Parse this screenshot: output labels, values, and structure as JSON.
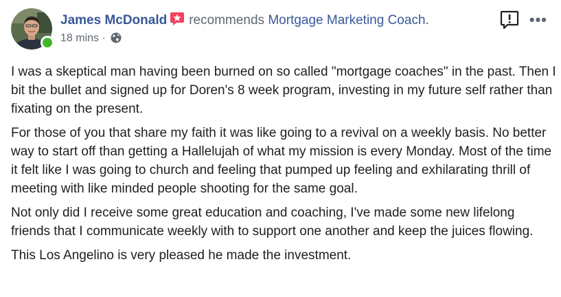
{
  "post": {
    "author_name": "James McDonald",
    "verb": "recommends",
    "page_name": "Mortgage Marketing Coach.",
    "time": "18 mins ·",
    "privacy_icon": "globe-icon",
    "recommend_icon": "recommend-star-icon",
    "report_icon": "report-flag-icon",
    "more_label": "•••",
    "online": true,
    "paragraphs": [
      "I was a skeptical man having been burned on so called \"mortgage coaches\" in the past. Then I bit the bullet and signed up for Doren's 8 week program, investing in my future self rather than fixating on the present.",
      "For those of you that share my faith it was like going to a revival on a weekly basis. No better way to start off than getting a Hallelujah of what my mission is every Monday. Most of the time it felt like I was going to church and feeling that pumped up feeling and exhilarating thrill of meeting with like minded people shooting for the same goal.",
      "Not only did I receive some great education and coaching, I've made some new lifelong friends that I communicate weekly with to support one another and keep the juices flowing.",
      "This Los Angelino is very pleased he made the investment."
    ]
  },
  "colors": {
    "link": "#385898",
    "meta_gray": "#606770",
    "text": "#1c1e21",
    "recommend_red": "#f3425f",
    "online_green": "#42b72a"
  }
}
